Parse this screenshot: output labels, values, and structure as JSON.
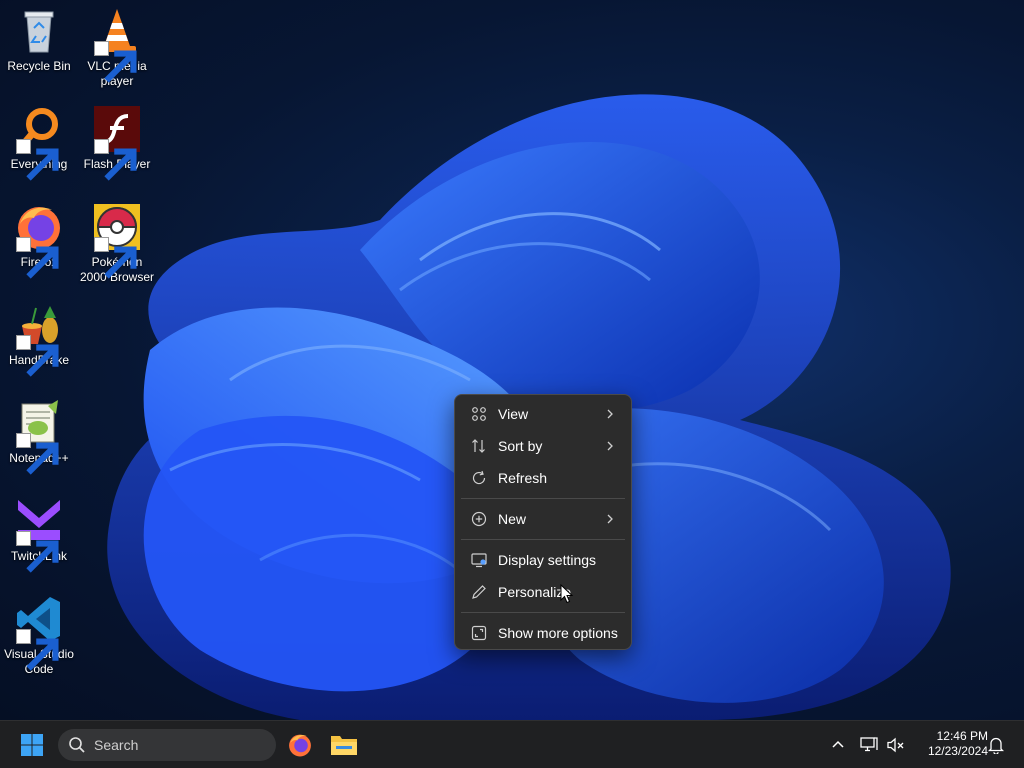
{
  "desktop": {
    "icons": [
      {
        "label": "Recycle Bin",
        "icon": "recycle-bin-icon"
      },
      {
        "label": "VLC media player",
        "icon": "vlc-icon"
      },
      {
        "label": "Everything",
        "icon": "everything-icon"
      },
      {
        "label": "Flash Player",
        "icon": "flash-player-icon"
      },
      {
        "label": "Firefox",
        "icon": "firefox-icon"
      },
      {
        "label": "Pokémon 2000 Browser",
        "icon": "pokeball-icon"
      },
      {
        "label": "HandBrake",
        "icon": "handbrake-icon"
      },
      {
        "label": "Notepad++",
        "icon": "notepad-plus-plus-icon"
      },
      {
        "label": "TwitchLink",
        "icon": "twitchlink-icon"
      },
      {
        "label": "Visual Studio Code",
        "icon": "vscode-icon"
      }
    ]
  },
  "context_menu": {
    "items": [
      {
        "label": "View",
        "icon": "grid-icon",
        "submenu": true
      },
      {
        "label": "Sort by",
        "icon": "sort-icon",
        "submenu": true
      },
      {
        "label": "Refresh",
        "icon": "refresh-icon",
        "submenu": false
      },
      {
        "label": "New",
        "icon": "plus-circle-icon",
        "submenu": true
      },
      {
        "label": "Display settings",
        "icon": "display-icon",
        "submenu": false
      },
      {
        "label": "Personalize",
        "icon": "pen-icon",
        "submenu": false
      },
      {
        "label": "Show more options",
        "icon": "expand-icon",
        "submenu": false
      }
    ]
  },
  "taskbar": {
    "search_placeholder": "Search",
    "pinned": [
      {
        "name": "Firefox",
        "icon": "firefox-icon"
      },
      {
        "name": "File Explorer",
        "icon": "folder-icon"
      }
    ],
    "clock": {
      "time": "12:46 PM",
      "date": "12/23/2024"
    }
  },
  "colors": {
    "menu_bg": "#2c2c2c",
    "taskbar_bg": "#1f2022",
    "accent_blue": "#2f6bff"
  }
}
